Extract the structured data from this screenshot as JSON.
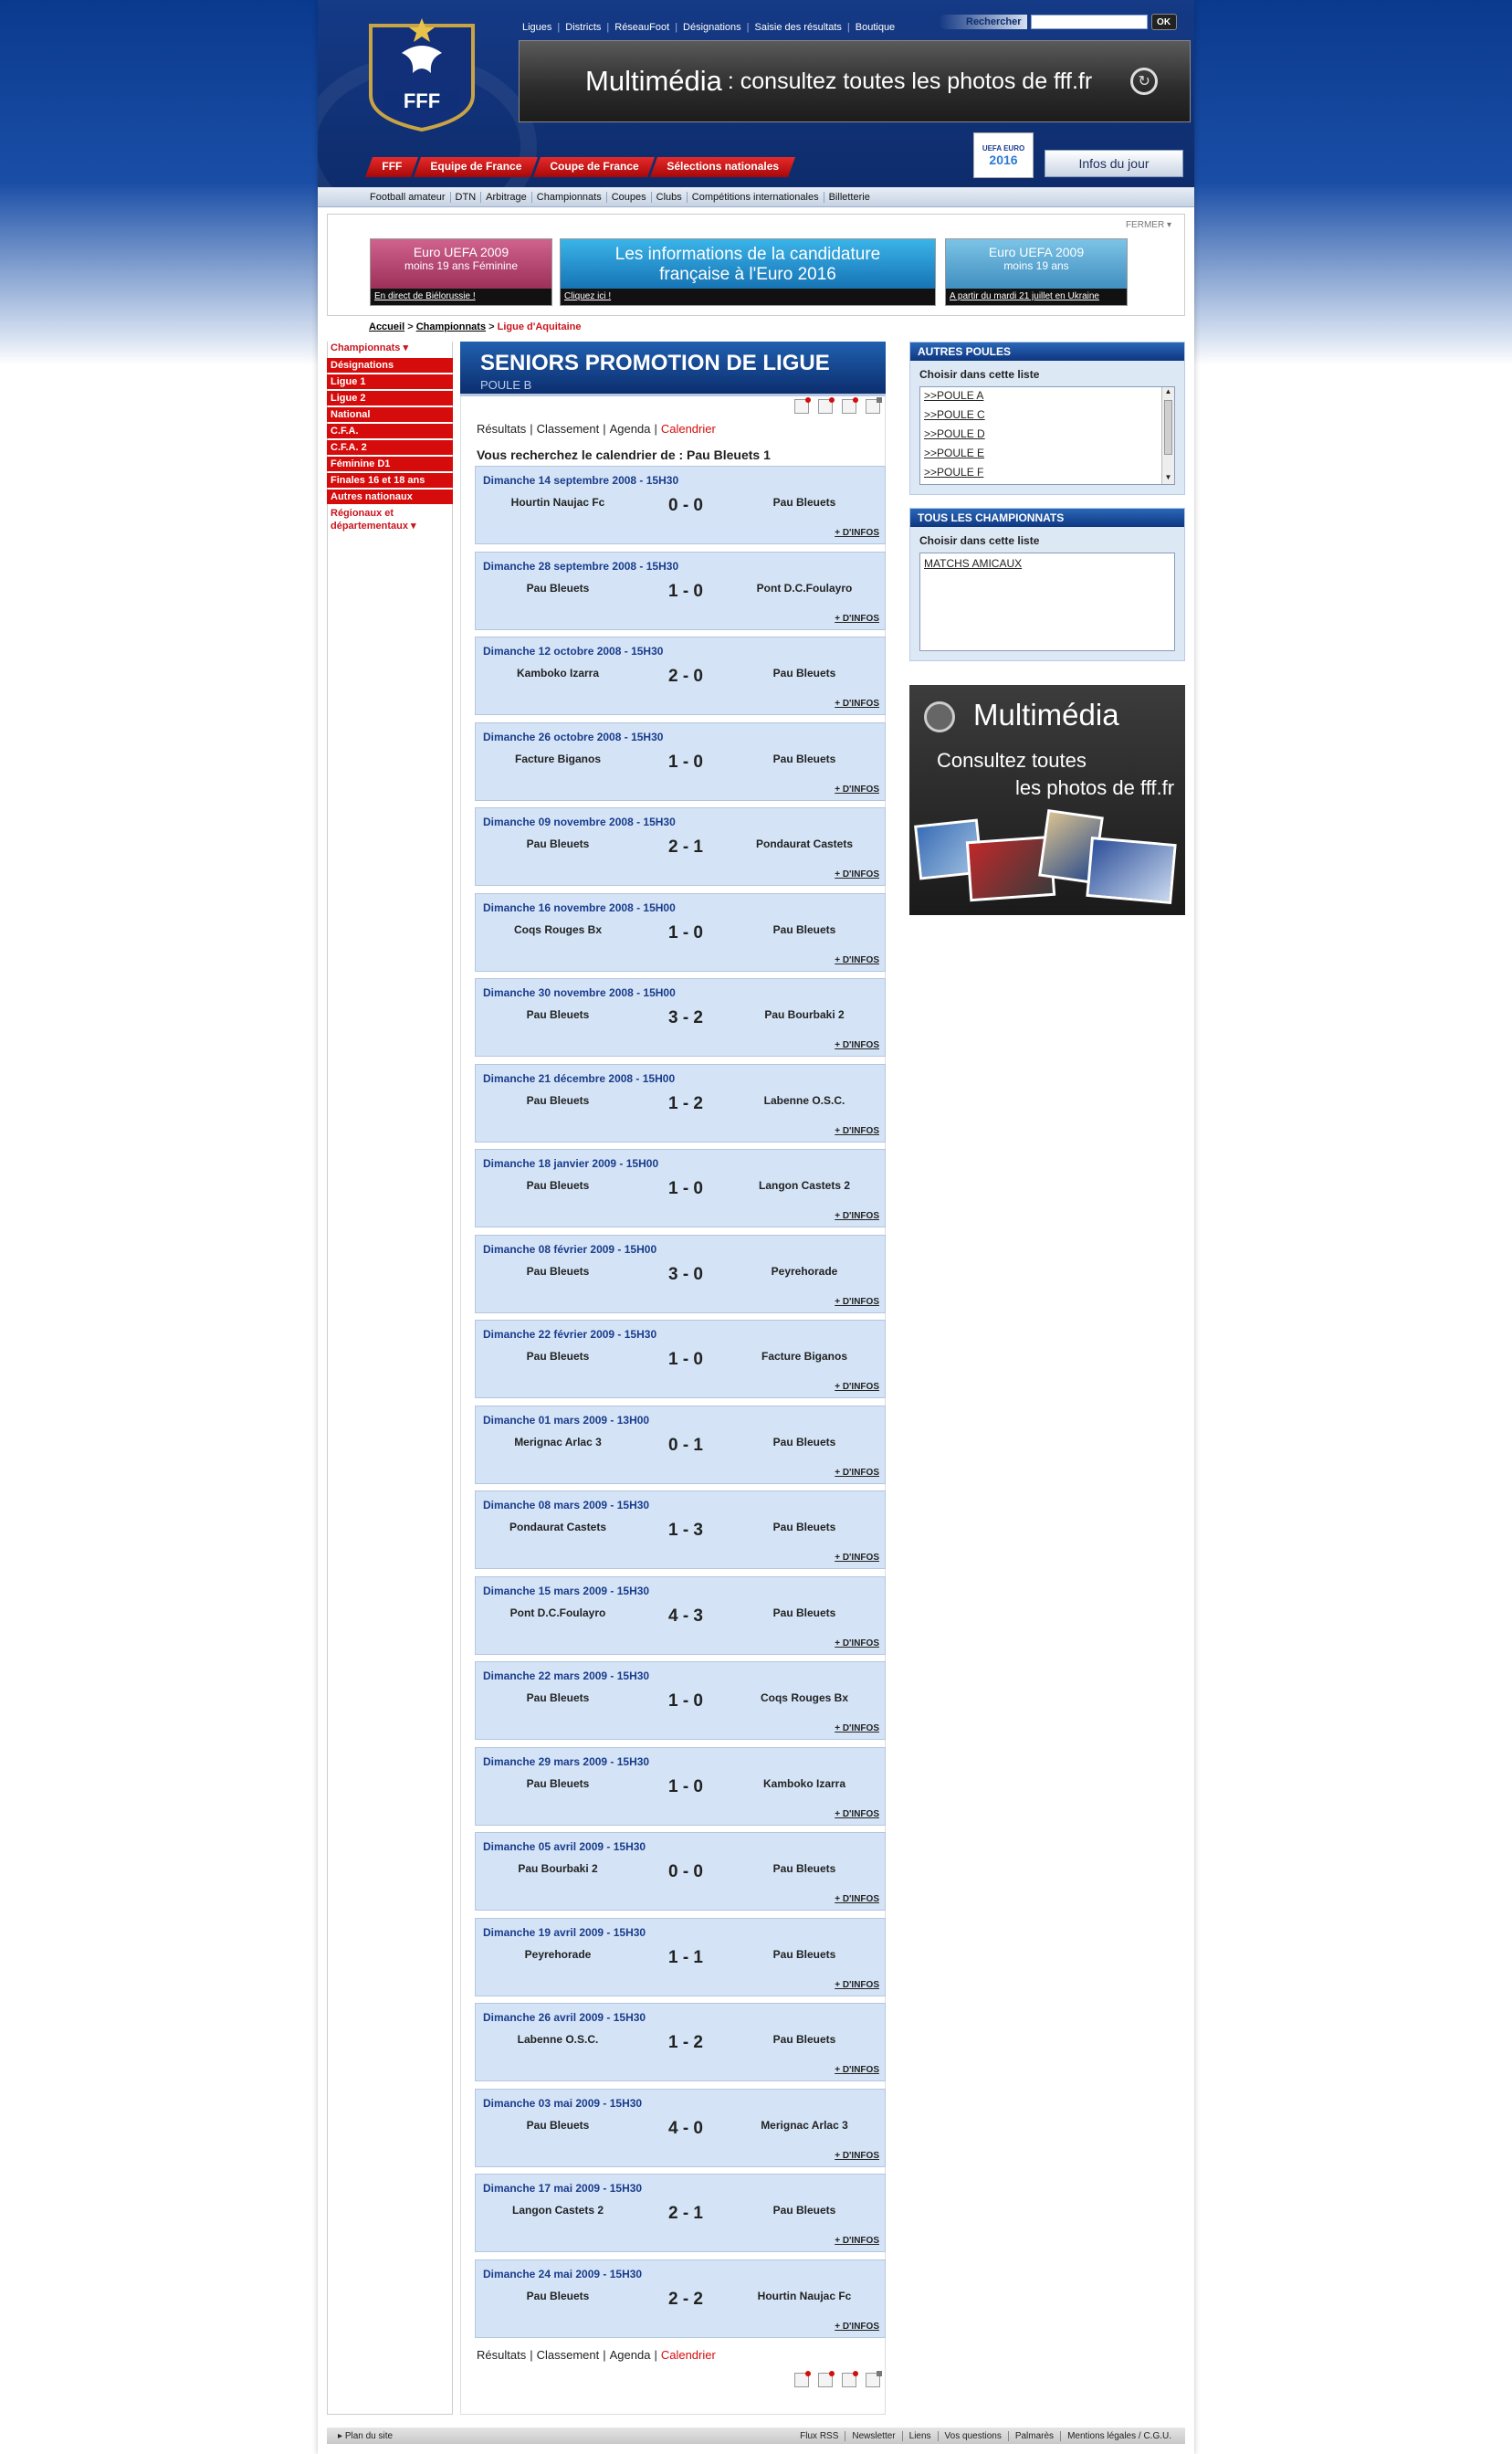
{
  "header": {
    "logo_text": "FFF",
    "top_links": [
      "Ligues",
      "Districts",
      "RéseauFoot",
      "Désignations",
      "Saisie des résultats",
      "Boutique"
    ],
    "search": {
      "label": "Rechercher",
      "value": "",
      "button": "OK"
    },
    "banner": {
      "big": "Multimédia",
      "rest": ": consultez toutes les photos de fff.fr"
    },
    "main_nav": [
      "FFF",
      "Equipe de France",
      "Coupe de France",
      "Sélections nationales"
    ],
    "euro_logo": {
      "top": "UEFA EURO",
      "year": "2016"
    },
    "infos_jour": "Infos du jour",
    "sub_nav": [
      "Football amateur",
      "DTN",
      "Arbitrage",
      "Championnats",
      "Coupes",
      "Clubs",
      "Compétitions internationales",
      "Billetterie"
    ]
  },
  "promo": {
    "close": "FERMER",
    "cards": [
      {
        "t1": "Euro UEFA 2009",
        "t2": "moins 19 ans Féminine",
        "foot": "En direct de Biélorussie !"
      },
      {
        "t1": "Les informations de la candidature",
        "t2": "française à l'Euro 2016",
        "foot": "Cliquez ici !"
      },
      {
        "t1": "Euro UEFA 2009",
        "t2": "moins 19 ans",
        "foot": "A partir du mardi 21 juillet en Ukraine"
      }
    ]
  },
  "breadcrumb": {
    "home": "Accueil",
    "section": "Championnats",
    "current": "Ligue d'Aquitaine"
  },
  "left_menu": {
    "head": "Championnats ▾",
    "items": [
      "Désignations",
      "Ligue 1",
      "Ligue 2",
      "National",
      "C.F.A.",
      "C.F.A. 2",
      "Féminine D1",
      "Finales 16 et 18 ans",
      "Autres nationaux"
    ],
    "foot": "Régionaux et départementaux ▾"
  },
  "center": {
    "title": "SENIORS PROMOTION DE LIGUE",
    "subtitle": "POULE B",
    "tabs": [
      "Résultats",
      "Classement",
      "Agenda",
      "Calendrier"
    ],
    "active_tab": "Calendrier",
    "search_text": "Vous recherchez le calendrier de : Pau Bleuets 1",
    "more_info": "+ D'INFOS",
    "matches": [
      {
        "date": "Dimanche 14 septembre 2008 - 15H30",
        "home": "Hourtin Naujac Fc",
        "score": "0 - 0",
        "away": "Pau Bleuets"
      },
      {
        "date": "Dimanche 28 septembre 2008 - 15H30",
        "home": "Pau Bleuets",
        "score": "1 - 0",
        "away": "Pont D.C.Foulayro"
      },
      {
        "date": "Dimanche 12 octobre 2008 - 15H30",
        "home": "Kamboko Izarra",
        "score": "2 - 0",
        "away": "Pau Bleuets"
      },
      {
        "date": "Dimanche 26 octobre 2008 - 15H30",
        "home": "Facture Biganos",
        "score": "1 - 0",
        "away": "Pau Bleuets"
      },
      {
        "date": "Dimanche 09 novembre 2008 - 15H30",
        "home": "Pau Bleuets",
        "score": "2 - 1",
        "away": "Pondaurat Castets"
      },
      {
        "date": "Dimanche 16 novembre 2008 - 15H00",
        "home": "Coqs Rouges Bx",
        "score": "1 - 0",
        "away": "Pau Bleuets"
      },
      {
        "date": "Dimanche 30 novembre 2008 - 15H00",
        "home": "Pau Bleuets",
        "score": "3 - 2",
        "away": "Pau Bourbaki 2"
      },
      {
        "date": "Dimanche 21 décembre 2008 - 15H00",
        "home": "Pau Bleuets",
        "score": "1 - 2",
        "away": "Labenne O.S.C."
      },
      {
        "date": "Dimanche 18 janvier 2009 - 15H00",
        "home": "Pau Bleuets",
        "score": "1 - 0",
        "away": "Langon Castets 2"
      },
      {
        "date": "Dimanche 08 février 2009 - 15H00",
        "home": "Pau Bleuets",
        "score": "3 - 0",
        "away": "Peyrehorade"
      },
      {
        "date": "Dimanche 22 février 2009 - 15H30",
        "home": "Pau Bleuets",
        "score": "1 - 0",
        "away": "Facture Biganos"
      },
      {
        "date": "Dimanche 01 mars 2009 - 13H00",
        "home": "Merignac Arlac 3",
        "score": "0 - 1",
        "away": "Pau Bleuets"
      },
      {
        "date": "Dimanche 08 mars 2009 - 15H30",
        "home": "Pondaurat Castets",
        "score": "1 - 3",
        "away": "Pau Bleuets"
      },
      {
        "date": "Dimanche 15 mars 2009 - 15H30",
        "home": "Pont D.C.Foulayro",
        "score": "4 - 3",
        "away": "Pau Bleuets"
      },
      {
        "date": "Dimanche 22 mars 2009 - 15H30",
        "home": "Pau Bleuets",
        "score": "1 - 0",
        "away": "Coqs Rouges Bx"
      },
      {
        "date": "Dimanche 29 mars 2009 - 15H30",
        "home": "Pau Bleuets",
        "score": "1 - 0",
        "away": "Kamboko Izarra"
      },
      {
        "date": "Dimanche 05 avril 2009 - 15H30",
        "home": "Pau Bourbaki 2",
        "score": "0 - 0",
        "away": "Pau Bleuets"
      },
      {
        "date": "Dimanche 19 avril 2009 - 15H30",
        "home": "Peyrehorade",
        "score": "1 - 1",
        "away": "Pau Bleuets"
      },
      {
        "date": "Dimanche 26 avril 2009 - 15H30",
        "home": "Labenne O.S.C.",
        "score": "1 - 2",
        "away": "Pau Bleuets"
      },
      {
        "date": "Dimanche 03 mai 2009 - 15H30",
        "home": "Pau Bleuets",
        "score": "4 - 0",
        "away": "Merignac Arlac 3"
      },
      {
        "date": "Dimanche 17 mai 2009 - 15H30",
        "home": "Langon Castets 2",
        "score": "2 - 1",
        "away": "Pau Bleuets"
      },
      {
        "date": "Dimanche 24 mai 2009 - 15H30",
        "home": "Pau Bleuets",
        "score": "2 - 2",
        "away": "Hourtin Naujac Fc"
      }
    ]
  },
  "right": {
    "autres_poules": {
      "title": "AUTRES POULES",
      "label": "Choisir dans cette liste",
      "options": [
        ">>POULE A",
        ">>POULE C",
        ">>POULE D",
        ">>POULE E",
        ">>POULE F"
      ]
    },
    "tous_championnats": {
      "title": "TOUS LES CHAMPIONNATS",
      "label": "Choisir dans cette liste",
      "options": [
        "MATCHS AMICAUX"
      ]
    },
    "multimedia": {
      "title": "Multimédia",
      "line1": "Consultez toutes",
      "line2": "les photos de fff.fr"
    }
  },
  "footer": {
    "plan": "Plan du site",
    "links": [
      "Flux RSS",
      "Newsletter",
      "Liens",
      "Vos questions",
      "Palmarès",
      "Mentions légales / C.G.U."
    ]
  }
}
